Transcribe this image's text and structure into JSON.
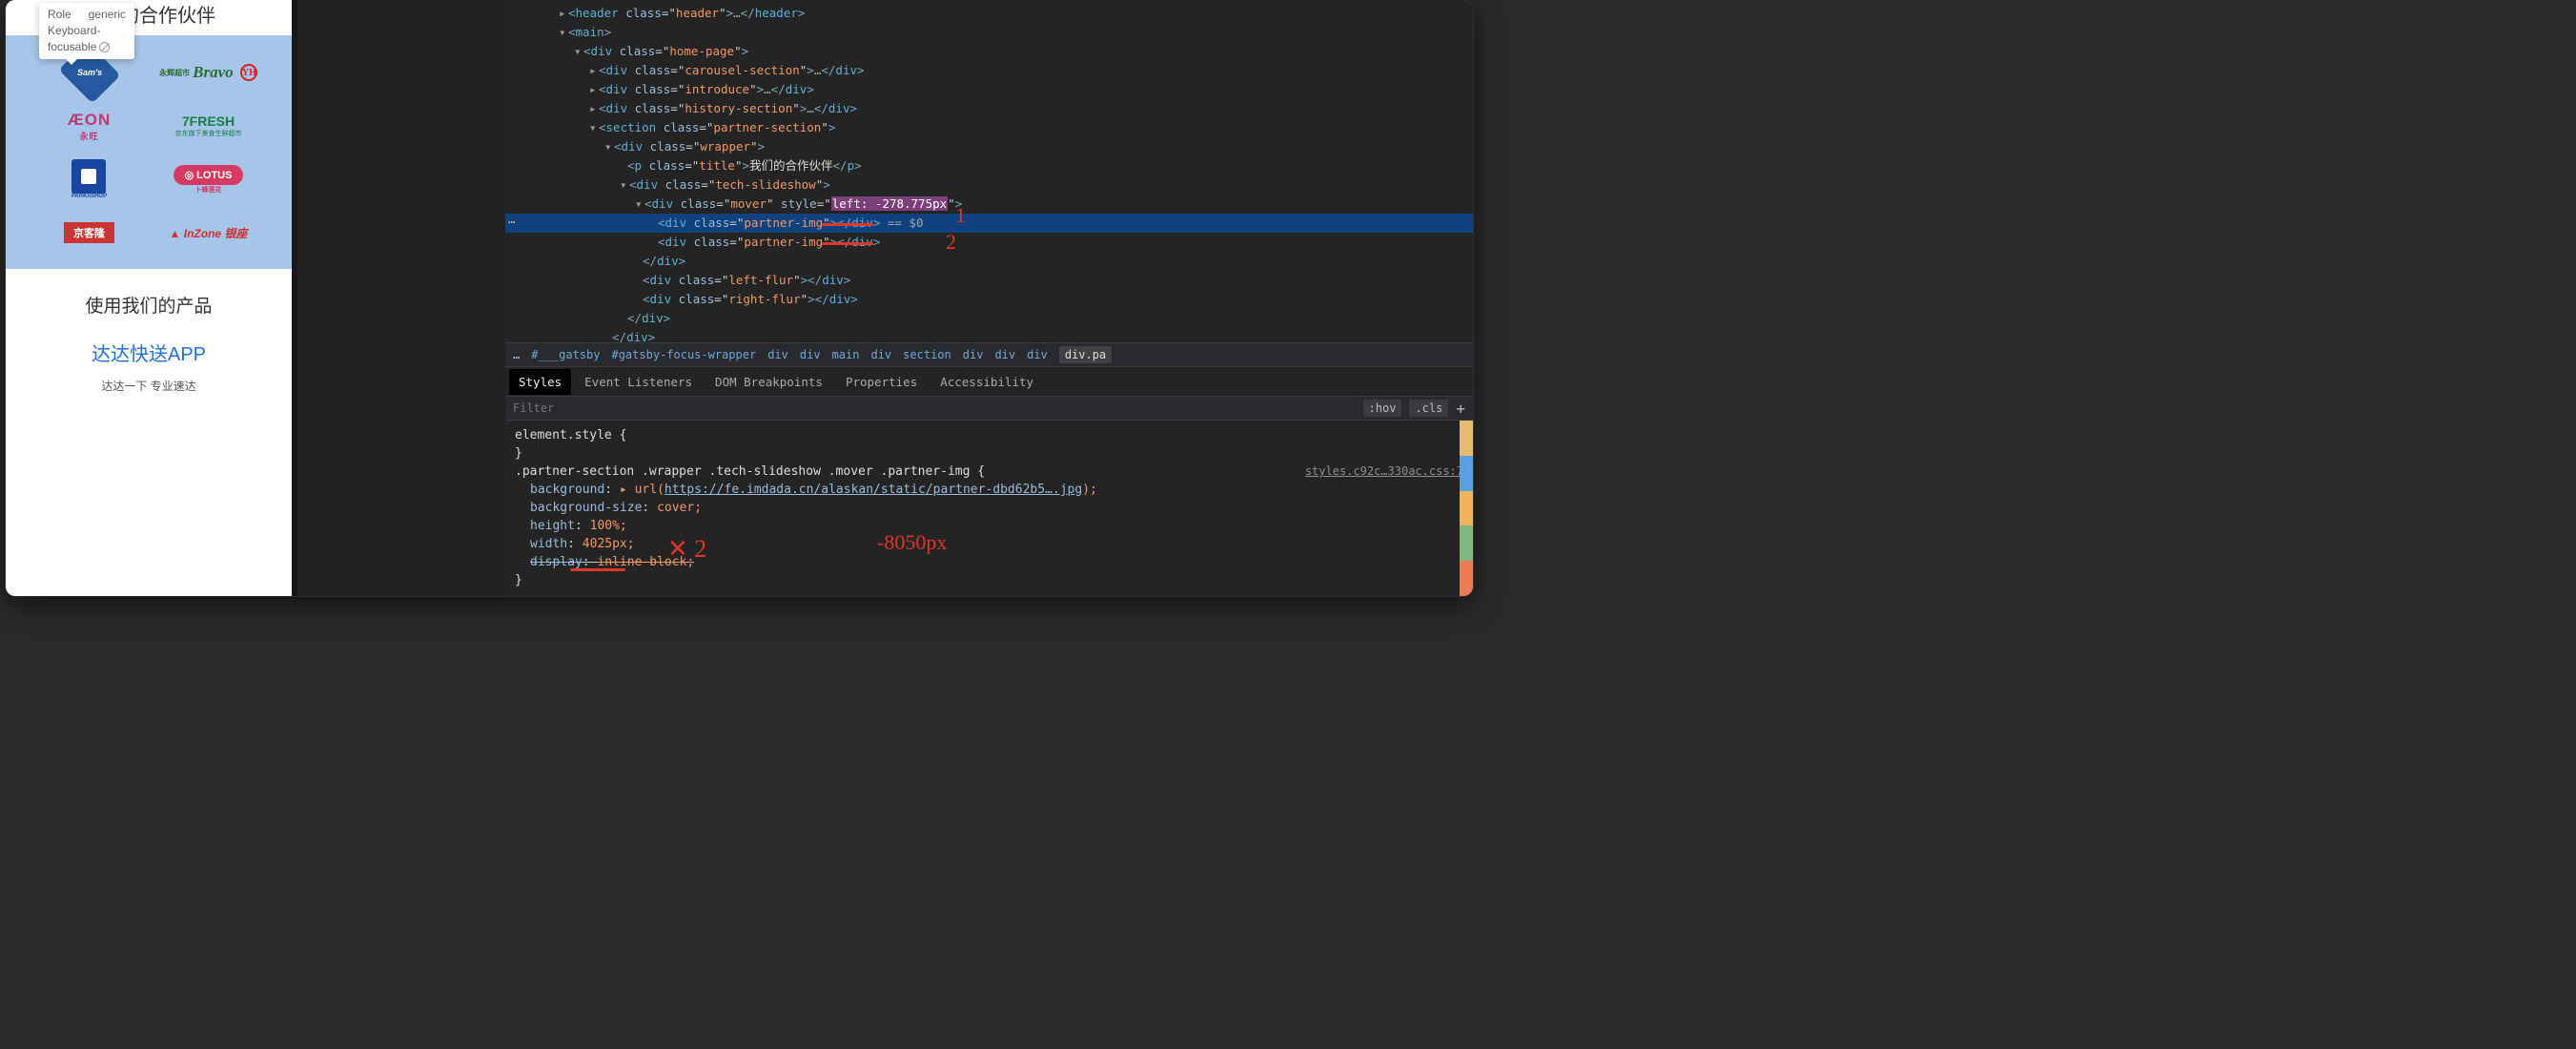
{
  "tooltip": {
    "role_label": "Role",
    "role_value": "generic",
    "focus_label": "Keyboard-focusable"
  },
  "page": {
    "partners_title": "我们的合作伙伴",
    "product_title": "使用我们的产品",
    "product_link": "达达快送APP",
    "product_sub": "达达一下 专业速达",
    "logos": {
      "sams": "Sam's",
      "bravo": "Bravo",
      "bravo_yh": "YH",
      "bravo_sup": "永辉超市",
      "aeon": "ÆON",
      "aeon_cn": "永旺",
      "fresh": "7FRESH",
      "fresh_sub": "京东旗下美食生鲜超市",
      "parkn": "P",
      "parkn_sub": "PARKnSHOP",
      "lotus": "◎ LOTUS",
      "lotus_sub": "卜蜂莲花",
      "jkl": "京客隆",
      "inzone": "InZone 银座"
    }
  },
  "dom": {
    "l0": "<header class=\"header\">…</header>",
    "l1": "<main>",
    "l2": "<div class=\"home-page\">",
    "l3": "<div class=\"carousel-section\">…</div>",
    "l4": "<div class=\"introduce\">…</div>",
    "l5": "<div class=\"history-section\">…</div>",
    "l6": "<section class=\"partner-section\">",
    "l7": "<div class=\"wrapper\">",
    "l8_a": "<p class=\"title\">",
    "l8_b": "我们的合作伙伴",
    "l8_c": "</p>",
    "l9": "<div class=\"tech-slideshow\">",
    "l10_a": "<div class=\"mover\" style=\"",
    "l10_b": "left: -278.775px",
    "l10_c": "\">",
    "l11": "<div class=\"partner-img\"></div>",
    "l11_badge": " == $0",
    "l12": "<div class=\"partner-img\"></div>",
    "l13": "</div>",
    "l14": "<div class=\"left-flur\"></div>",
    "l15": "<div class=\"right-flur\"></div>",
    "l16": "</div>",
    "l17": "</div>",
    "l18": "</div>",
    "gutter_dots": "…"
  },
  "crumbs": {
    "ell": "…",
    "c1": "#___gatsby",
    "c2": "#gatsby-focus-wrapper",
    "c3": "div",
    "c4": "div",
    "c5": "main",
    "c6": "div",
    "c7": "section",
    "c8": "div",
    "c9": "div",
    "c10": "div",
    "last": "div.pa"
  },
  "styles_tabs": {
    "styles": "Styles",
    "ev": "Event Listeners",
    "dom": "DOM Breakpoints",
    "prop": "Properties",
    "acc": "Accessibility"
  },
  "filter": {
    "placeholder": "Filter",
    "hov": ":hov",
    "cls": ".cls"
  },
  "css": {
    "elem_sel": "element.style {",
    "elem_close": "}",
    "rule_sel": ".partner-section .wrapper .tech-slideshow .mover .partner-img {",
    "link": "styles.c92c…330ac.css:7",
    "p1": "background",
    "v1": "▸ url(",
    "v1u": "https://fe.imdada.cn/alaskan/static/partner-dbd62b5….jpg",
    "v1c": ");",
    "p2": "background-size",
    "v2": "cover;",
    "p3": "height",
    "v3": "100%;",
    "p4": "width",
    "v4": "4025px;",
    "p5": "display",
    "v5": "inline-block;",
    "close2": "}"
  },
  "annotations": {
    "one": "1",
    "two": "2",
    "mult": "✕ 2",
    "neg": "-8050px"
  },
  "palette": [
    "#e6ba73",
    "#5aa0e0",
    "#f0b45a",
    "#7fb77e",
    "#e87b55"
  ]
}
